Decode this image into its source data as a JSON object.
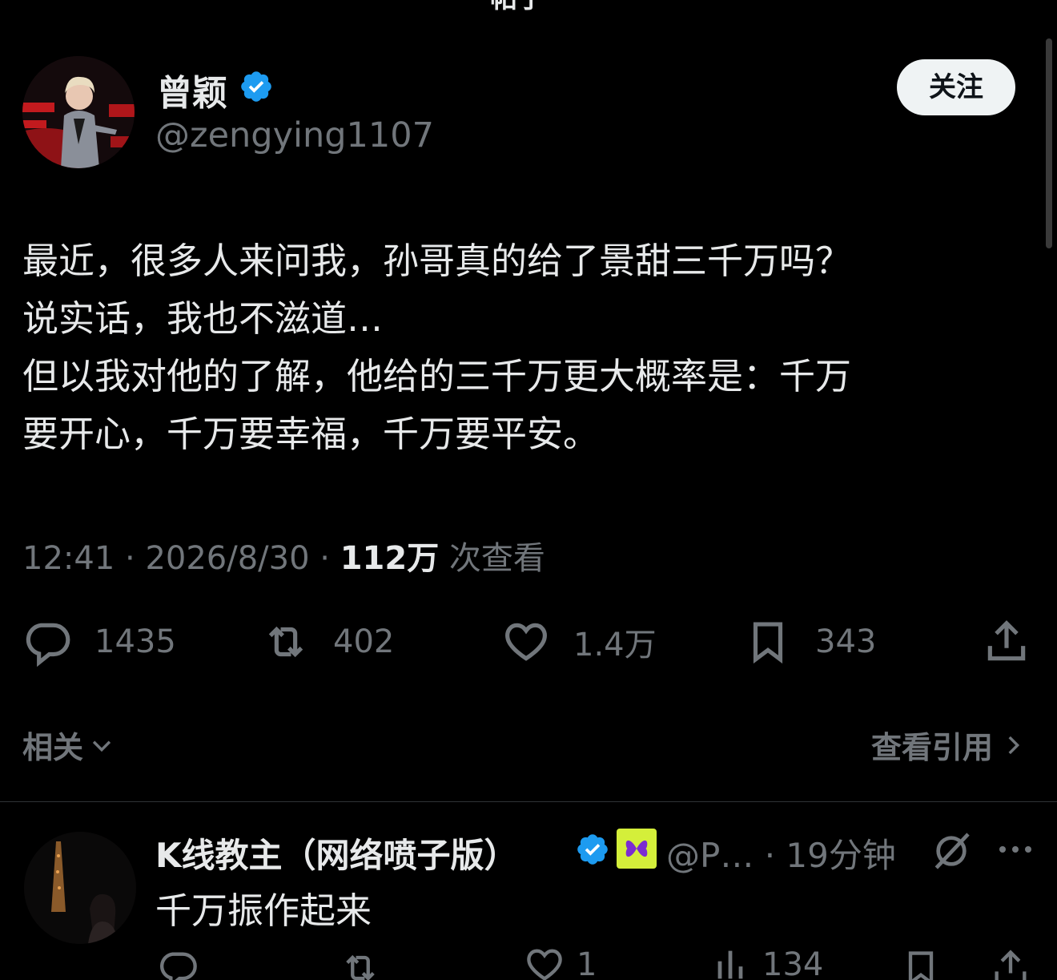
{
  "header": {
    "title": "帖子"
  },
  "author": {
    "name": "曾颖",
    "handle": "@zengying1107",
    "follow_label": "关注"
  },
  "tweet": {
    "text": "最近，很多人来问我，孙哥真的给了景甜三千万吗？\n说实话，我也不滋道…\n但以我对他的了解，他给的三千万更大概率是：千万\n要开心，千万要幸福，千万要平安。"
  },
  "meta": {
    "time": "12:41",
    "date": "2026/8/30",
    "views": "112万",
    "views_label": "次查看"
  },
  "actions": {
    "replies": "1435",
    "retweets": "402",
    "likes": "1.4万",
    "bookmarks": "343"
  },
  "related": {
    "label": "相关",
    "quotes_label": "查看引用"
  },
  "reply": {
    "name": "K线教主（网络喷子版）",
    "handle": "@P…",
    "time": "19分钟",
    "text": "千万振作起来",
    "likes": "1",
    "views": "134"
  },
  "colors": {
    "background": "#000000",
    "text": "#e7e9ea",
    "muted": "#71767b",
    "verified_blue": "#1d9bf0",
    "follow_bg": "#eff3f4",
    "badge_yellow": "#d4ef3a"
  },
  "icons": [
    "back-arrow-icon",
    "verified-icon",
    "reply-icon",
    "retweet-icon",
    "like-icon",
    "bookmark-icon",
    "share-icon",
    "chevron-down-icon",
    "chevron-right-icon",
    "grok-icon",
    "more-icon",
    "views-icon"
  ]
}
